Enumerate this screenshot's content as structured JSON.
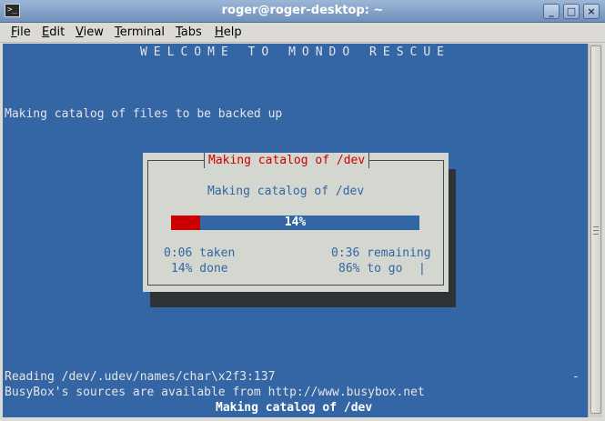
{
  "window": {
    "title": "roger@roger-desktop: ~",
    "buttons": {
      "minimize": "_",
      "maximize": "□",
      "close": "×"
    }
  },
  "menu": {
    "items": [
      {
        "mnemonic": "F",
        "rest": "ile"
      },
      {
        "mnemonic": "E",
        "rest": "dit"
      },
      {
        "mnemonic": "V",
        "rest": "iew"
      },
      {
        "mnemonic": "T",
        "rest": "erminal"
      },
      {
        "mnemonic": "T",
        "rest": "abs"
      },
      {
        "mnemonic": "H",
        "rest": "elp"
      }
    ]
  },
  "terminal": {
    "welcome": "WELCOME TO MONDO RESCUE",
    "status_line": "Making catalog of files to be backed up",
    "dialog": {
      "title": "Making catalog of /dev",
      "message": "Making catalog of /dev",
      "progress": {
        "value": 0.14,
        "label": "14%"
      },
      "time_taken": "0:06 taken",
      "time_remaining": "0:36 remaining",
      "percent_done": "14% done",
      "percent_to_go": "86% to go",
      "spinner": "|"
    },
    "reading_line": "Reading /dev/.udev/names/char\\x2f3:137",
    "reading_marker": "-",
    "busybox_line": "BusyBox's sources are available from http://www.busybox.net",
    "bottom_status": "Making catalog of /dev"
  },
  "colors": {
    "terminal_bg": "#3465a4",
    "dialog_bg": "#d3d7cf",
    "dialog_title": "#cc0000",
    "progress_fill": "#cc0000"
  }
}
